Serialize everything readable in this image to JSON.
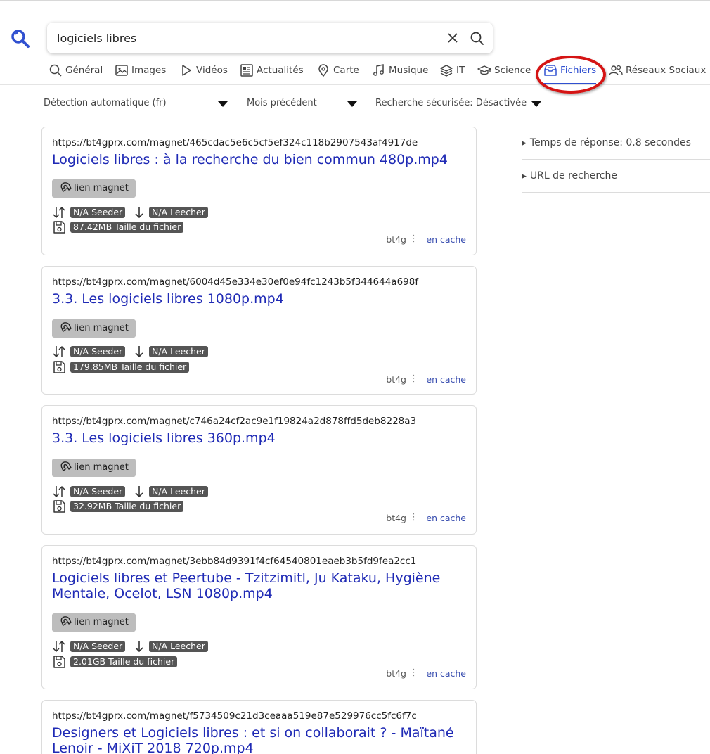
{
  "search": {
    "query": "logiciels libres",
    "placeholder": ""
  },
  "tabs": [
    {
      "label": "Général",
      "icon": "search-icon"
    },
    {
      "label": "Images",
      "icon": "image-icon"
    },
    {
      "label": "Vidéos",
      "icon": "play-icon"
    },
    {
      "label": "Actualités",
      "icon": "newspaper-icon"
    },
    {
      "label": "Carte",
      "icon": "map-pin-icon"
    },
    {
      "label": "Musique",
      "icon": "music-note-icon"
    },
    {
      "label": "IT",
      "icon": "layers-icon"
    },
    {
      "label": "Science",
      "icon": "graduation-cap-icon"
    },
    {
      "label": "Fichiers",
      "icon": "file-box-icon",
      "active": true
    },
    {
      "label": "Réseaux Sociaux",
      "icon": "people-icon"
    }
  ],
  "filters": {
    "language": "Détection automatique (fr)",
    "time_range": "Mois précédent",
    "safe_search": "Recherche sécurisée: Désactivée"
  },
  "results": [
    {
      "url": "https://bt4gprx.com/magnet/465cdac5e6c5cf5ef324c118b2907543af4917de",
      "title": "Logiciels libres : à la recherche du bien commun 480p.mp4",
      "magnet_label": "lien magnet",
      "seeder": "N/A Seeder",
      "leecher": "N/A Leecher",
      "size": "87.42MB Taille du fichier",
      "engine": "bt4g",
      "cache": "en cache"
    },
    {
      "url": "https://bt4gprx.com/magnet/6004d45e334e30ef0e94fc1243b5f344644a698f",
      "title": "3.3. Les logiciels libres 1080p.mp4",
      "magnet_label": "lien magnet",
      "seeder": "N/A Seeder",
      "leecher": "N/A Leecher",
      "size": "179.85MB Taille du fichier",
      "engine": "bt4g",
      "cache": "en cache"
    },
    {
      "url": "https://bt4gprx.com/magnet/c746a24cf2ac9e1f19824a2d878ffd5deb8228a3",
      "title": "3.3. Les logiciels libres 360p.mp4",
      "magnet_label": "lien magnet",
      "seeder": "N/A Seeder",
      "leecher": "N/A Leecher",
      "size": "32.92MB Taille du fichier",
      "engine": "bt4g",
      "cache": "en cache"
    },
    {
      "url": "https://bt4gprx.com/magnet/3ebb84d9391f4cf64540801eaeb3b5fd9fea2cc1",
      "title": "Logiciels libres et Peertube - Tzitzimitl, Ju Kataku, Hygiène Mentale, Ocelot, LSN 1080p.mp4",
      "magnet_label": "lien magnet",
      "seeder": "N/A Seeder",
      "leecher": "N/A Leecher",
      "size": "2.01GB Taille du fichier",
      "engine": "bt4g",
      "cache": "en cache"
    },
    {
      "url": "https://bt4gprx.com/magnet/f5734509c21d3ceaaa519e87e529976cc5fc6f7c",
      "title": "Designers et Logiciels libres : et si on collaborait ? - Maïtané Lenoir - MiXiT 2018 720p.mp4"
    }
  ],
  "sidebar": {
    "response_time": "Temps de réponse: 0.8 secondes",
    "search_url": "URL de recherche"
  },
  "colors": {
    "accent": "#3050d0",
    "link": "#1f2ab5",
    "badge": "#555555",
    "magnet_button": "#bdbdbd",
    "highlight_ring": "#d51414"
  }
}
